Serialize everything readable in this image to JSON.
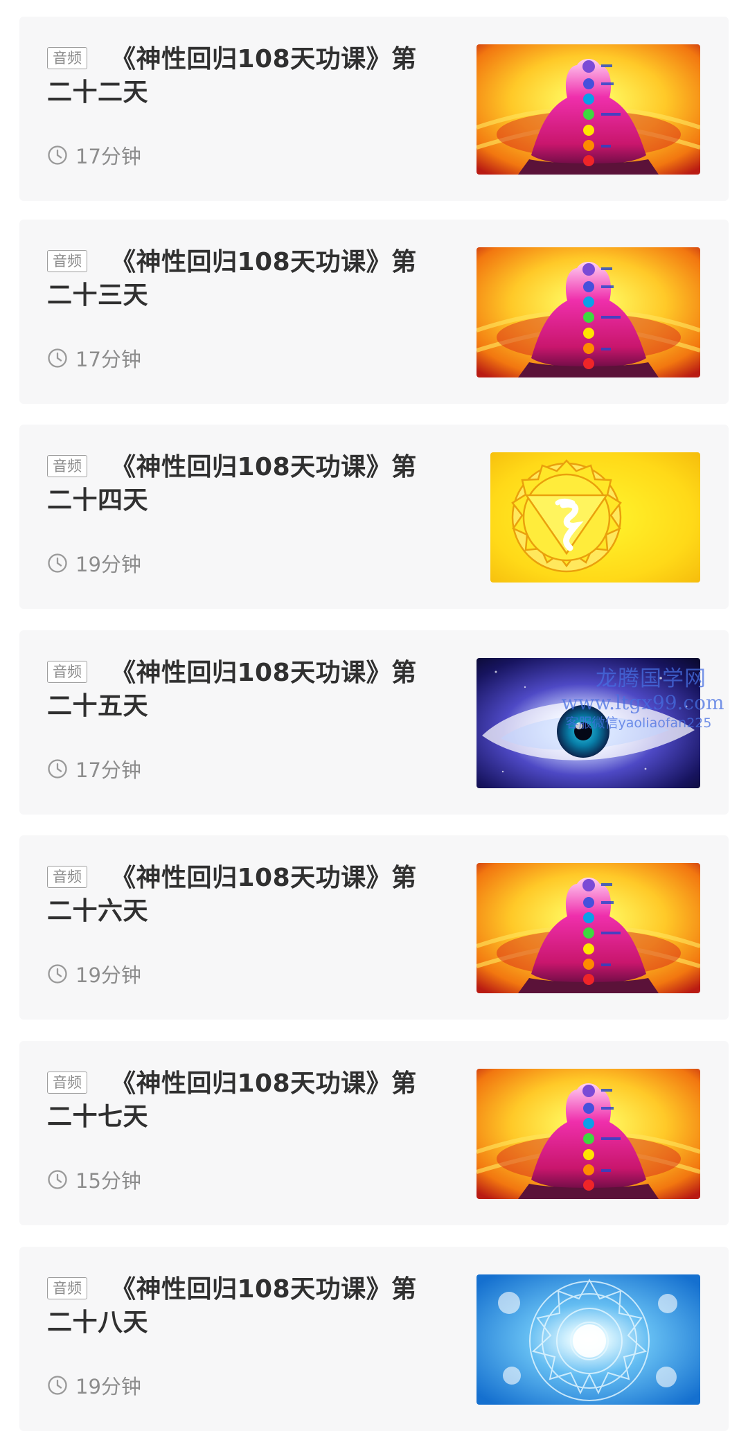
{
  "lessons": [
    {
      "tag": "音频",
      "title": "《神性回归108天功课》第二十二天",
      "duration": "17分钟",
      "thumbnail": "chakra-meditation-image"
    },
    {
      "tag": "音频",
      "title": "《神性回归108天功课》第二十三天",
      "duration": "17分钟",
      "thumbnail": "chakra-meditation-image"
    },
    {
      "tag": "音频",
      "title": "《神性回归108天功课》第二十四天",
      "duration": "19分钟",
      "thumbnail": "solar-plexus-chakra-symbol-image"
    },
    {
      "tag": "音频",
      "title": "《神性回归108天功课》第二十五天",
      "duration": "17分钟",
      "thumbnail": "cosmic-eye-image"
    },
    {
      "tag": "音频",
      "title": "《神性回归108天功课》第二十六天",
      "duration": "19分钟",
      "thumbnail": "chakra-meditation-image"
    },
    {
      "tag": "音频",
      "title": "《神性回归108天功课》第二十七天",
      "duration": "15分钟",
      "thumbnail": "chakra-meditation-image"
    },
    {
      "tag": "音频",
      "title": "《神性回归108天功课》第二十八天",
      "duration": "19分钟",
      "thumbnail": "blue-mandala-image"
    }
  ],
  "watermark": {
    "line1": "龙腾国学网",
    "line2": "www.ltgx99.com",
    "line3": "客服微信yaoliaofan225"
  },
  "colors": {
    "page_background": "#ffffff",
    "card_background": "#f7f7f8",
    "title_text": "#303030",
    "secondary_text": "#8d8d8d",
    "watermark_text": "#466ee1"
  }
}
